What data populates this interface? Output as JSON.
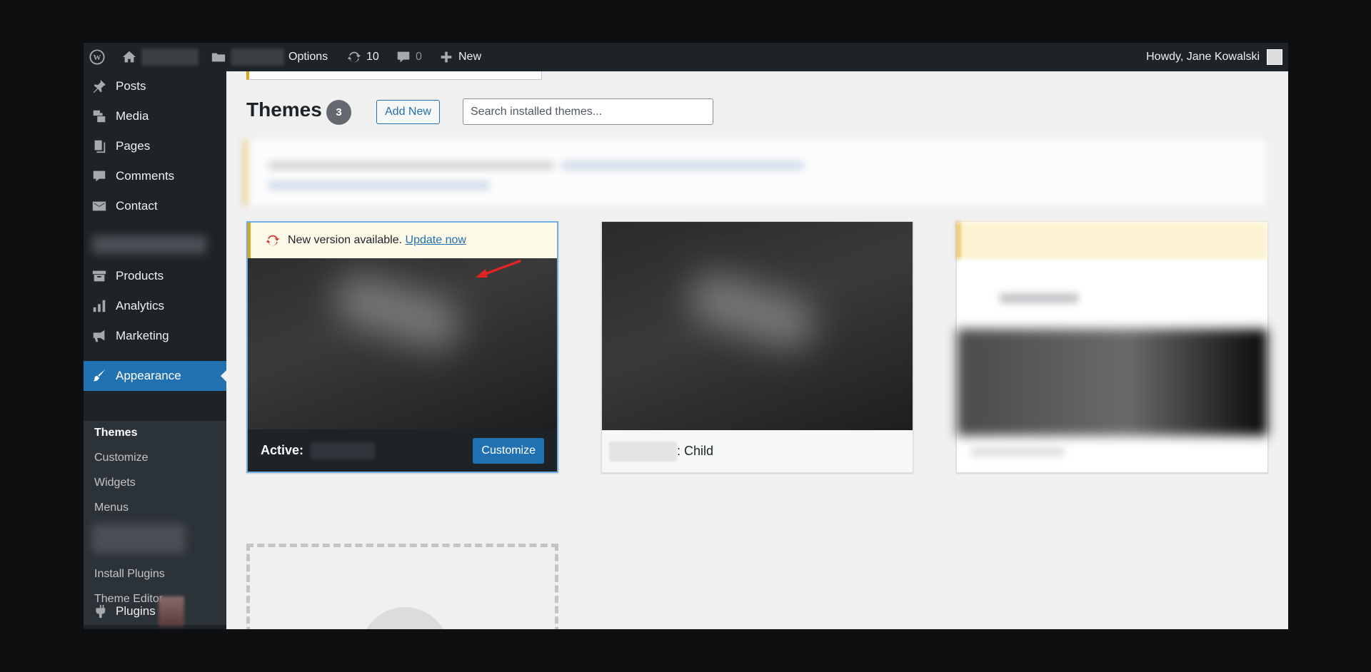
{
  "adminbar": {
    "options_label": "Options",
    "updates_count": "10",
    "comments_count": "0",
    "new_label": "New",
    "greeting": "Howdy, Jane Kowalski"
  },
  "sidebar": {
    "items": [
      {
        "label": "Posts",
        "icon": "pushpin-icon"
      },
      {
        "label": "Media",
        "icon": "media-icon"
      },
      {
        "label": "Pages",
        "icon": "pages-icon"
      },
      {
        "label": "Comments",
        "icon": "comment-icon"
      },
      {
        "label": "Contact",
        "icon": "mail-icon"
      },
      {
        "label": "Products",
        "icon": "archive-icon"
      },
      {
        "label": "Analytics",
        "icon": "chart-bar-icon"
      },
      {
        "label": "Marketing",
        "icon": "megaphone-icon"
      },
      {
        "label": "Appearance",
        "icon": "brush-icon"
      },
      {
        "label": "Plugins",
        "icon": "plugin-icon"
      }
    ],
    "submenu": [
      "Themes",
      "Customize",
      "Widgets",
      "Menus",
      "Install Plugins",
      "Theme Editor"
    ]
  },
  "main": {
    "title": "Themes",
    "theme_count": "3",
    "add_new_label": "Add New",
    "search_placeholder": "Search installed themes...",
    "update_notice_text": "New version available.",
    "update_link": "Update now",
    "active_label": "Active:",
    "customize_label": "Customize",
    "child_theme_suffix": ": Child"
  },
  "colors": {
    "accent": "#2271b1",
    "adminbar": "#1d2327",
    "warning": "#dba617",
    "annotation": "#e02424"
  }
}
